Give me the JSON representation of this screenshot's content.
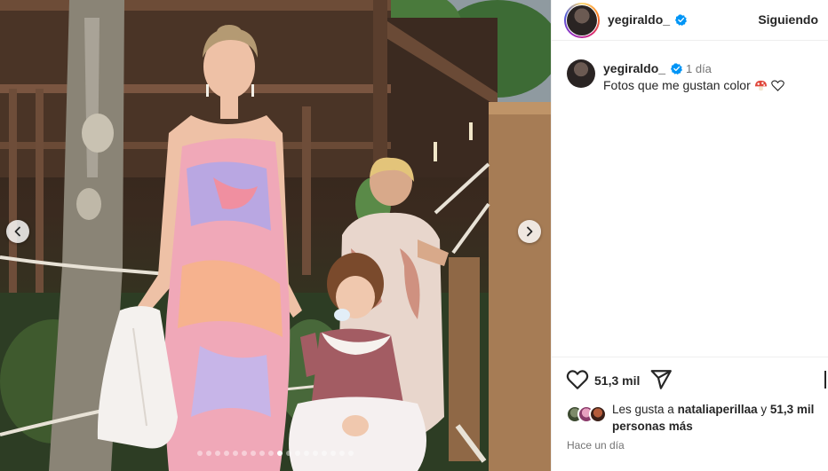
{
  "post": {
    "username": "yegiraldo_",
    "follow_label": "Siguiendo",
    "caption": {
      "username": "yegiraldo_",
      "time": "1 día",
      "text": "Fotos que me gustan color"
    },
    "likes": {
      "count": "51,3 mil",
      "prefix": "Les gusta a",
      "first_user": "nataliaperillaa",
      "connector": "y",
      "others_bold": "51,3 mil",
      "others_rest": "personas más"
    },
    "date": "Hace un día"
  },
  "carousel": {
    "total_slides": 18,
    "active_index": 9
  },
  "icons": {
    "prev": "chevron-left-icon",
    "next": "chevron-right-icon",
    "verified": "verified-badge-icon",
    "like": "heart-icon",
    "share": "paper-plane-icon",
    "bookmark": "bookmark-icon",
    "emojis": [
      "mushroom-emoji-icon",
      "white-heart-emoji-icon"
    ]
  },
  "colors": {
    "verified": "#0095f6",
    "text": "#262626",
    "muted": "#737373",
    "divider": "#efefef"
  }
}
